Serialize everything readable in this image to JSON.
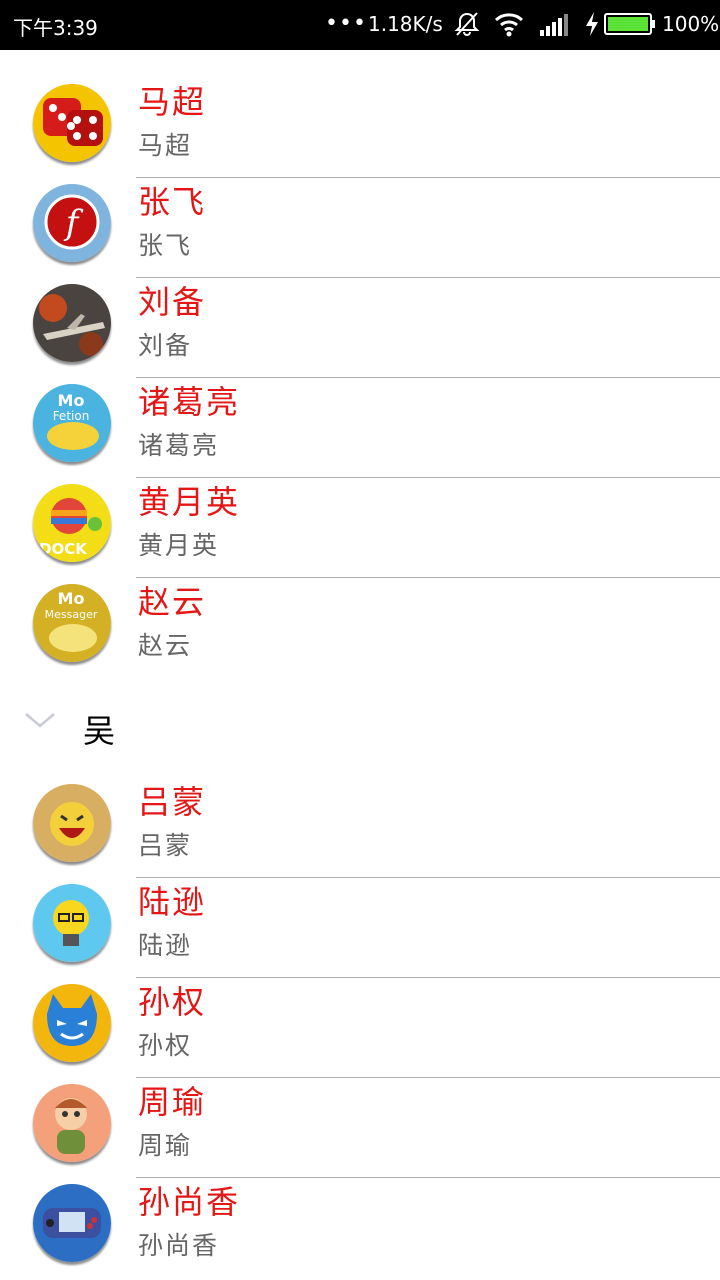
{
  "status_bar": {
    "time": "下午3:39",
    "dots": "•••",
    "net_speed": "1.18K/s",
    "battery_percent": "100%",
    "battery_level": 1.0,
    "icons": [
      "mute-bell-icon",
      "wifi-icon",
      "signal-icon",
      "charging-bolt-icon",
      "battery-icon"
    ]
  },
  "group1": {
    "items": [
      {
        "name": "马超",
        "sub": "马超",
        "icon": "dice-icon"
      },
      {
        "name": "张飞",
        "sub": "张飞",
        "icon": "flash-icon"
      },
      {
        "name": "刘备",
        "sub": "刘备",
        "icon": "jet-icon"
      },
      {
        "name": "诸葛亮",
        "sub": "诸葛亮",
        "icon": "mo-fetion-icon"
      },
      {
        "name": "黄月英",
        "sub": "黄月英",
        "icon": "dock-icon"
      },
      {
        "name": "赵云",
        "sub": "赵云",
        "icon": "mo-messager-icon"
      }
    ]
  },
  "group2": {
    "title": "吴",
    "chevron_icon": "chevron-down-icon",
    "items": [
      {
        "name": "吕蒙",
        "sub": "吕蒙",
        "icon": "laughing-face-icon"
      },
      {
        "name": "陆逊",
        "sub": "陆逊",
        "icon": "lightbulb-icon"
      },
      {
        "name": "孙权",
        "sub": "孙权",
        "icon": "blue-mask-icon"
      },
      {
        "name": "周瑜",
        "sub": "周瑜",
        "icon": "cartoon-kid-icon"
      },
      {
        "name": "孙尚香",
        "sub": "孙尚香",
        "icon": "gameboy-icon"
      }
    ]
  },
  "colors": {
    "name_red": "#e41616",
    "sub_gray": "#666666",
    "divider": "#b0b0b0",
    "battery_green": "#5be236"
  }
}
